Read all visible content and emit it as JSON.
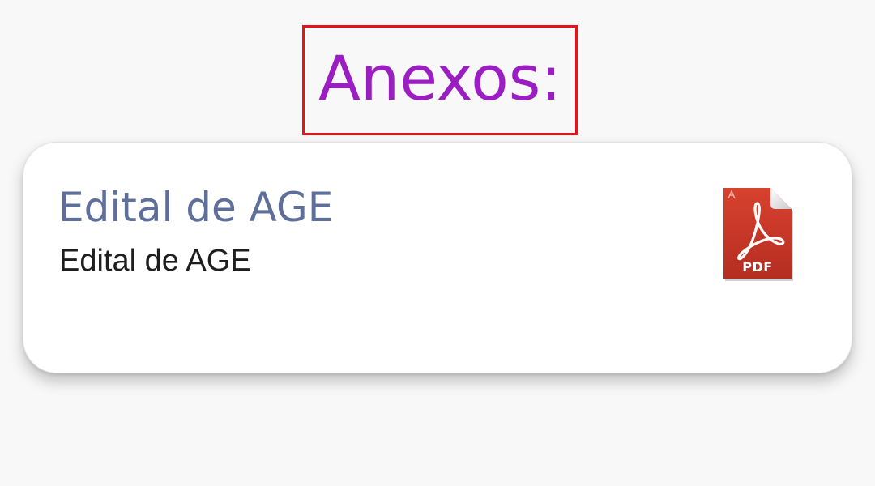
{
  "header": {
    "title": "Anexos:"
  },
  "attachments": [
    {
      "title": "Edital de AGE",
      "description": "Edital de AGE",
      "file_type": "PDF",
      "icon": "pdf-file-icon"
    }
  ],
  "colors": {
    "title": "#9b1ec2",
    "highlight_border": "#e8121b",
    "card_title": "#5f6f9b",
    "card_text": "#1e1e1e",
    "pdf_red": "#c9352a",
    "background": "#f8f8f8"
  }
}
